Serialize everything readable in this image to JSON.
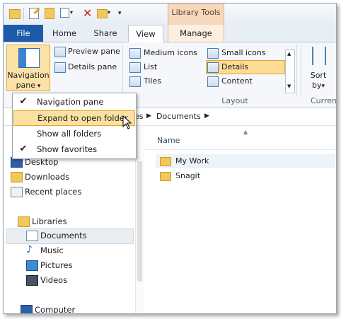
{
  "contextual_tab_group": "Library Tools",
  "tabs": {
    "file": "File",
    "home": "Home",
    "share": "Share",
    "view": "View",
    "manage": "Manage"
  },
  "ribbon": {
    "navigation_pane": "Navigation pane",
    "navigation_pane_line1": "Navigation",
    "navigation_pane_line2": "pane",
    "preview_pane": "Preview pane",
    "details_pane": "Details pane",
    "layout": {
      "medium_icons": "Medium icons",
      "small_icons": "Small icons",
      "list": "List",
      "details": "Details",
      "tiles": "Tiles",
      "content": "Content",
      "group_label": "Layout",
      "selected": "Details"
    },
    "sort_by_line1": "Sort",
    "sort_by_line2": "by",
    "current_view_partial": "Curren"
  },
  "address": {
    "segment1_partial": "ies",
    "segment2": "Documents"
  },
  "nav_menu": {
    "items": [
      {
        "label": "Navigation pane",
        "checked": true
      },
      {
        "label": "Expand to open folder",
        "checked": false,
        "highlighted": true
      },
      {
        "label": "Show all folders",
        "checked": false
      },
      {
        "label": "Show favorites",
        "checked": true
      }
    ]
  },
  "nav_pane": {
    "favorites": [
      "Desktop",
      "Downloads",
      "Recent places"
    ],
    "libraries_label": "Libraries",
    "libraries": [
      "Documents",
      "Music",
      "Pictures",
      "Videos"
    ],
    "selected": "Documents",
    "computer_partial": "Computer"
  },
  "content": {
    "column_name": "Name",
    "items": [
      "My Work",
      "Snagit"
    ]
  }
}
